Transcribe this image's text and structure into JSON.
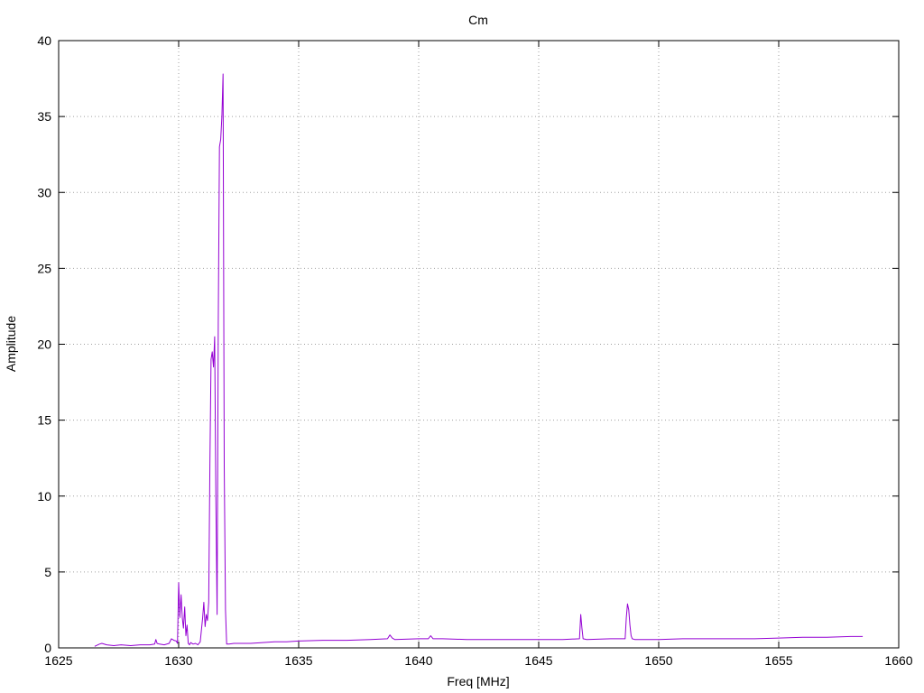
{
  "chart_data": {
    "type": "line",
    "title": "Cm",
    "xlabel": "Freq [MHz]",
    "ylabel": "Amplitude",
    "xlim": [
      1625,
      1660
    ],
    "ylim": [
      0,
      40
    ],
    "xticks": [
      1625,
      1630,
      1635,
      1640,
      1645,
      1650,
      1655,
      1660
    ],
    "yticks": [
      0,
      5,
      10,
      15,
      20,
      25,
      30,
      35,
      40
    ],
    "grid": true,
    "colors": {
      "series": "#9400d3",
      "grid": "#a0a0a0",
      "axis": "#000000"
    },
    "series": [
      {
        "x": [
          1626.5,
          1626.7,
          1626.8,
          1627.0,
          1627.3,
          1627.6,
          1628.0,
          1628.4,
          1628.8,
          1629.0,
          1629.05,
          1629.1,
          1629.2,
          1629.4,
          1629.6,
          1629.7,
          1629.8,
          1629.9,
          1629.95,
          1630.0,
          1630.05,
          1630.1,
          1630.15,
          1630.2,
          1630.25,
          1630.3,
          1630.35,
          1630.4,
          1630.45,
          1630.5,
          1630.6,
          1630.7,
          1630.8,
          1630.9,
          1631.0,
          1631.05,
          1631.1,
          1631.15,
          1631.2,
          1631.25,
          1631.3,
          1631.35,
          1631.4,
          1631.45,
          1631.5,
          1631.55,
          1631.6,
          1631.65,
          1631.7,
          1631.75,
          1631.8,
          1631.85,
          1631.9,
          1631.95,
          1632.0,
          1632.1,
          1632.3,
          1632.6,
          1633.0,
          1633.5,
          1634.0,
          1634.5,
          1635.0,
          1636.0,
          1637.0,
          1638.0,
          1638.7,
          1638.8,
          1638.9,
          1639.0,
          1640.0,
          1640.4,
          1640.5,
          1640.6,
          1641.0,
          1642.0,
          1643.0,
          1644.0,
          1645.0,
          1646.0,
          1646.7,
          1646.75,
          1646.8,
          1646.85,
          1647.0,
          1648.0,
          1648.6,
          1648.65,
          1648.7,
          1648.75,
          1648.8,
          1648.85,
          1648.9,
          1649.0,
          1650.0,
          1651.0,
          1652.0,
          1653.0,
          1654.0,
          1655.0,
          1656.0,
          1657.0,
          1658.0,
          1658.5
        ],
        "y": [
          0.1,
          0.25,
          0.3,
          0.2,
          0.15,
          0.2,
          0.15,
          0.2,
          0.2,
          0.25,
          0.55,
          0.3,
          0.25,
          0.2,
          0.3,
          0.6,
          0.5,
          0.45,
          0.3,
          4.3,
          2.0,
          3.5,
          2.0,
          1.3,
          2.7,
          0.8,
          1.5,
          0.3,
          0.2,
          0.35,
          0.25,
          0.3,
          0.2,
          0.4,
          2.0,
          3.0,
          1.4,
          2.2,
          1.8,
          3.0,
          12.0,
          19.0,
          19.5,
          18.5,
          20.5,
          10.0,
          2.2,
          21.5,
          33.0,
          33.5,
          35.0,
          37.8,
          12.0,
          2.5,
          0.25,
          0.25,
          0.3,
          0.3,
          0.3,
          0.35,
          0.4,
          0.4,
          0.45,
          0.5,
          0.5,
          0.55,
          0.6,
          0.85,
          0.65,
          0.55,
          0.6,
          0.6,
          0.8,
          0.6,
          0.6,
          0.55,
          0.55,
          0.55,
          0.55,
          0.55,
          0.6,
          2.2,
          1.3,
          0.6,
          0.55,
          0.6,
          0.6,
          2.0,
          2.9,
          2.5,
          1.5,
          0.8,
          0.6,
          0.55,
          0.55,
          0.6,
          0.6,
          0.6,
          0.6,
          0.65,
          0.7,
          0.7,
          0.75,
          0.75
        ]
      }
    ]
  }
}
